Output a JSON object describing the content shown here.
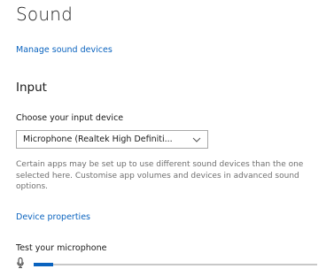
{
  "page": {
    "title": "Sound",
    "manage_link": "Manage sound devices"
  },
  "input": {
    "heading": "Input",
    "choose_label": "Choose your input device",
    "selected_device": "Microphone (Realtek High Definiti...",
    "description": "Certain apps may be set up to use different sound devices than the one selected here. Customise app volumes and devices in advanced sound options.",
    "device_properties_link": "Device properties",
    "test_label": "Test your microphone",
    "mic_level_fraction": 0.07
  },
  "colors": {
    "accent": "#0a63bf",
    "track": "#c8c8c8"
  },
  "icons": {
    "select_chevron": "chevron-down-icon",
    "mic": "microphone-icon"
  }
}
